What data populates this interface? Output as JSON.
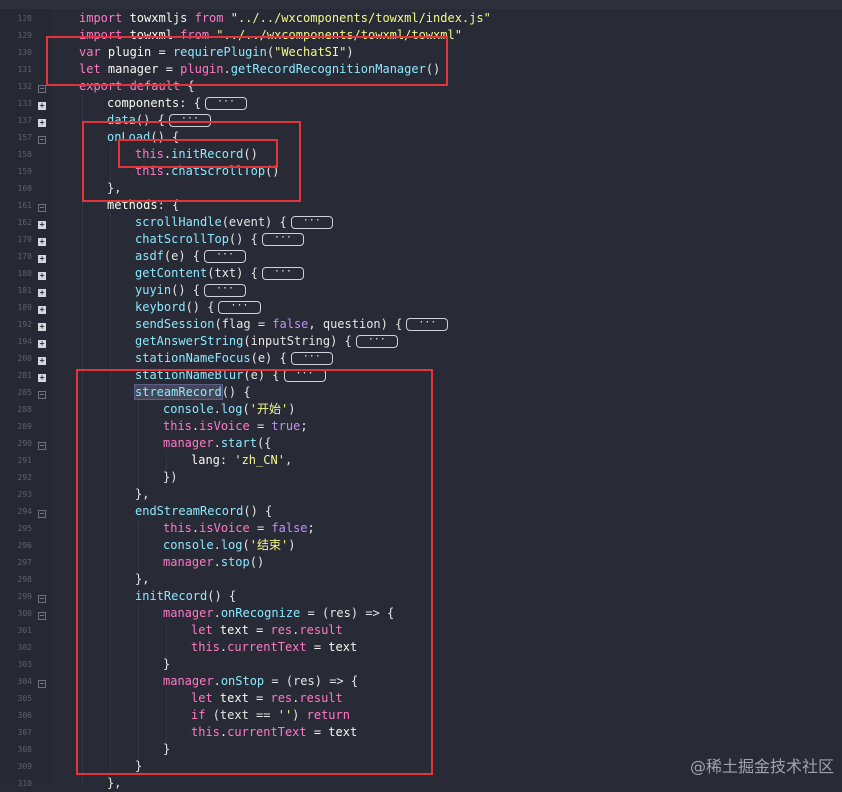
{
  "editor": {
    "line_numbers": [
      "128",
      "129",
      "130",
      "131",
      "132",
      "133",
      "137",
      "157",
      "158",
      "159",
      "160",
      "161",
      "162",
      "170",
      "178",
      "180",
      "181",
      "189",
      "192",
      "194",
      "200",
      "281",
      "285",
      "288",
      "289",
      "290",
      "291",
      "292",
      "293",
      "294",
      "295",
      "296",
      "297",
      "298",
      "299",
      "300",
      "301",
      "302",
      "303",
      "304",
      "305",
      "306",
      "307",
      "308",
      "309",
      "310"
    ],
    "collapsed_marker": "···",
    "lines": {
      "l128": {
        "t1": "import ",
        "t2": "towxmljs ",
        "t3": "from ",
        "t4": "\"../../wxcomponents/towxml/index.js\""
      },
      "l129": {
        "t1": "import ",
        "t2": "towxml ",
        "t3": "from ",
        "t4": "\"../../wxcomponents/towxml/towxml\""
      },
      "l130": {
        "t1": "var ",
        "t2": "plugin = ",
        "t3": "requirePlugin",
        "t4": "(",
        "t5": "\"WechatSI\"",
        "t6": ")"
      },
      "l131": {
        "t1": "let ",
        "t2": "manager = ",
        "t3": "plugin",
        "t4": ".",
        "t5": "getRecordRecognitionManager",
        "t6": "()"
      },
      "l132": {
        "t1": "export ",
        "t2": "default ",
        "t3": "{"
      },
      "l133": {
        "t1": "components",
        "t2": ": {"
      },
      "l137": {
        "t1": "data",
        "t2": "() {"
      },
      "l157": {
        "t1": "onLoad",
        "t2": "() {"
      },
      "l158": {
        "t1": "this",
        "t2": ".",
        "t3": "initRecord",
        "t4": "()"
      },
      "l159": {
        "t1": "this",
        "t2": ".",
        "t3": "chatScrollTop",
        "t4": "()"
      },
      "l160": {
        "t1": "},"
      },
      "l161": {
        "t1": "methods",
        "t2": ": {"
      },
      "l162": {
        "t1": "scrollHandle",
        "t2": "(event) {"
      },
      "l170": {
        "t1": "chatScrollTop",
        "t2": "() {"
      },
      "l178": {
        "t1": "asdf",
        "t2": "(e) {"
      },
      "l180": {
        "t1": "getContent",
        "t2": "(txt) {"
      },
      "l181": {
        "t1": "yuyin",
        "t2": "() {"
      },
      "l189": {
        "t1": "keybord",
        "t2": "() {"
      },
      "l192": {
        "t1": "sendSession",
        "t2": "(flag = ",
        "t3": "false",
        "t4": ", question) {"
      },
      "l194": {
        "t1": "getAnswerString",
        "t2": "(inputString) {"
      },
      "l200": {
        "t1": "stationNameFocus",
        "t2": "(e) {"
      },
      "l281": {
        "t1": "stationNameBlur",
        "t2": "(e) {"
      },
      "l285": {
        "t1": "streamRecord",
        "t2": "() {"
      },
      "l288": {
        "t1": "console",
        "t2": ".",
        "t3": "log",
        "t4": "(",
        "t5": "'开始'",
        "t6": ")"
      },
      "l289": {
        "t1": "this",
        "t2": ".",
        "t3": "isVoice",
        "t4": " = ",
        "t5": "true",
        "t6": ";"
      },
      "l290": {
        "t1": "manager",
        "t2": ".",
        "t3": "start",
        "t4": "({"
      },
      "l291": {
        "t1": "lang",
        "t2": ": ",
        "t3": "'zh_CN'",
        "t4": ","
      },
      "l292": {
        "t1": "})"
      },
      "l293": {
        "t1": "},"
      },
      "l294": {
        "t1": "endStreamRecord",
        "t2": "() {"
      },
      "l295": {
        "t1": "this",
        "t2": ".",
        "t3": "isVoice",
        "t4": " = ",
        "t5": "false",
        "t6": ";"
      },
      "l296": {
        "t1": "console",
        "t2": ".",
        "t3": "log",
        "t4": "(",
        "t5": "'结束'",
        "t6": ")"
      },
      "l297": {
        "t1": "manager",
        "t2": ".",
        "t3": "stop",
        "t4": "()"
      },
      "l298": {
        "t1": "},"
      },
      "l299": {
        "t1": "initRecord",
        "t2": "() {"
      },
      "l300": {
        "t1": "manager",
        "t2": ".",
        "t3": "onRecognize",
        "t4": " = (res) => {"
      },
      "l301": {
        "t1": "let ",
        "t2": "text = ",
        "t3": "res",
        "t4": ".",
        "t5": "result"
      },
      "l302": {
        "t1": "this",
        "t2": ".",
        "t3": "currentText",
        "t4": " = text"
      },
      "l303": {
        "t1": "}"
      },
      "l304": {
        "t1": "manager",
        "t2": ".",
        "t3": "onStop",
        "t4": " = (res) => {"
      },
      "l305": {
        "t1": "let ",
        "t2": "text = ",
        "t3": "res",
        "t4": ".",
        "t5": "result"
      },
      "l306": {
        "t1": "if ",
        "t2": "(text == ",
        "t3": "''",
        "t4": ") ",
        "t5": "return"
      },
      "l307": {
        "t1": "this",
        "t2": ".",
        "t3": "currentText",
        "t4": " = text"
      },
      "l308": {
        "t1": "}"
      },
      "l309": {
        "t1": "}"
      },
      "l310": {
        "t1": "},"
      }
    }
  },
  "annotation_color": "#e5333a",
  "watermark": "@稀土掘金技术社区"
}
